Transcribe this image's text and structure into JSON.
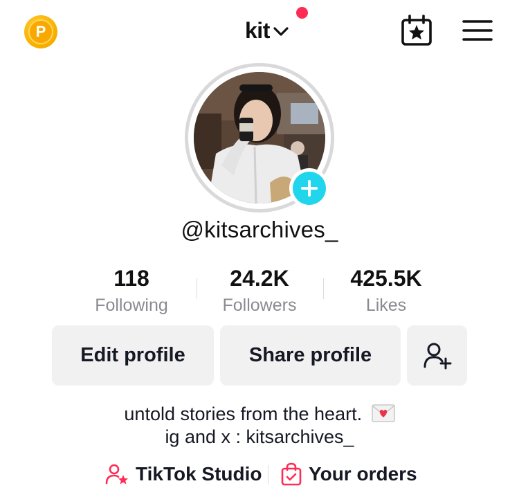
{
  "header": {
    "coin_letter": "P",
    "username_title": "kit",
    "colors": {
      "notification_dot": "#fe2c55",
      "coin": "#f9b100"
    },
    "icons": [
      "coin-icon",
      "chevron-down-icon",
      "calendar-star-icon",
      "hamburger-menu-icon"
    ]
  },
  "profile": {
    "handle": "@kitsarchives_",
    "avatar_description_icon": "avatar-photo",
    "add_story_icon": "plus-icon",
    "accent_color": "#20d5ec"
  },
  "stats": [
    {
      "value": "118",
      "label": "Following"
    },
    {
      "value": "24.2K",
      "label": "Followers"
    },
    {
      "value": "425.5K",
      "label": "Likes"
    }
  ],
  "actions": {
    "edit_label": "Edit profile",
    "share_label": "Share profile",
    "add_friend_icon": "add-friend-icon"
  },
  "bio": {
    "line1": "untold stories from the heart.",
    "line2": "ig and x : kitsarchives_",
    "emoji_icon": "love-letter-icon"
  },
  "links": {
    "studio_label": "TikTok Studio",
    "orders_label": "Your orders",
    "accent": "#fe2c55"
  }
}
